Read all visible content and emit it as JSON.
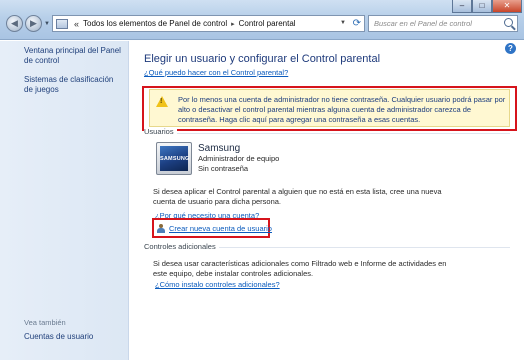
{
  "addressbar": {
    "chevron": "«",
    "crumb1": "Todos los elementos de Panel de control",
    "separator": "▸",
    "crumb2": "Control parental",
    "search_placeholder": "Buscar en el Panel de control"
  },
  "window_controls": {
    "minimize": "–",
    "maximize": "□",
    "close": "✕"
  },
  "sidebar": {
    "items": [
      {
        "label": "Ventana principal del Panel de control"
      },
      {
        "label": "Sistemas de clasificación de juegos"
      }
    ],
    "see_also_heading": "Vea también",
    "see_also_items": [
      {
        "label": "Cuentas de usuario"
      }
    ]
  },
  "main": {
    "title": "Elegir un usuario y configurar el Control parental",
    "what_link": "¿Qué puedo hacer con el Control parental?",
    "warning": "Por lo menos una cuenta de administrador no tiene contraseña. Cualquier usuario podrá pasar por alto o desactivar el control parental mientras alguna cuenta de administrador carezca de contraseña. Haga clic aquí para agregar una contraseña a esas cuentas.",
    "users_label": "Usuarios",
    "account": {
      "picture_text": "SAMSUNG",
      "name": "Samsung",
      "role": "Administrador de equipo",
      "password_status": "Sin contraseña"
    },
    "add_user_text": "Si desea aplicar el Control parental a alguien que no está en esta lista, cree una nueva cuenta de usuario para dicha persona.",
    "why_link": "¿Por qué necesito una cuenta?",
    "create_link": "Crear nueva cuenta de usuario",
    "additional_label": "Controles adicionales",
    "additional_text": "Si desea usar características adicionales como Filtrado web e Informe de actividades en este equipo, debe instalar controles adicionales.",
    "install_link": "¿Cómo instalo controles adicionales?"
  },
  "colors": {
    "link": "#0b5bbd",
    "title": "#1e3a7b",
    "highlight_outline": "#d6141c",
    "warning_bg": "#fff8d2"
  }
}
